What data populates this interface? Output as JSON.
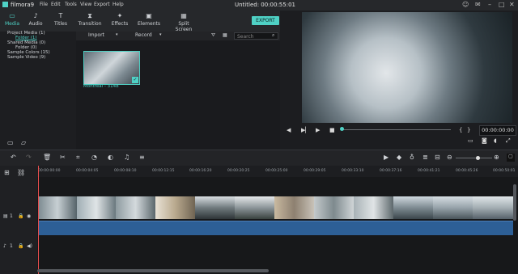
{
  "app": {
    "logo": "filmora9",
    "title": "Untitled:  00:00:55:01"
  },
  "menu": [
    "File",
    "Edit",
    "Tools",
    "View",
    "Export",
    "Help"
  ],
  "tabs": [
    {
      "label": "Media",
      "icon": "folder-icon",
      "active": true
    },
    {
      "label": "Audio",
      "icon": "music-note-icon"
    },
    {
      "label": "Titles",
      "icon": "text-icon"
    },
    {
      "label": "Transition",
      "icon": "transition-icon"
    },
    {
      "label": "Effects",
      "icon": "effects-icon"
    },
    {
      "label": "Elements",
      "icon": "image-icon"
    },
    {
      "label": "Split Screen",
      "icon": "split-screen-icon"
    }
  ],
  "export_label": "EXPORT",
  "library": {
    "items": [
      "Project Media (1)",
      "Folder (1)",
      "Shared Media (0)",
      "Folder (0)",
      "Sample Colors (15)",
      "Sample Video (9)"
    ]
  },
  "media_toolbar": {
    "import_label": "Import",
    "record_label": "Record",
    "search_placeholder": "Search"
  },
  "media_items": [
    {
      "name": "Montreal - 3148"
    }
  ],
  "player": {
    "timecode": "00:00:00:00"
  },
  "ruler_ticks": [
    "00:00:00:00",
    "00:00:04:05",
    "00:00:08:10",
    "00:00:12:15",
    "00:00:16:20",
    "00:00:20:25",
    "00:00:25:00",
    "00:00:29:05",
    "00:00:33:10",
    "00:00:37:16",
    "00:00:41:21",
    "00:00:45:26",
    "00:00:50:01"
  ],
  "tracks": {
    "video_label": "1",
    "audio_label": "1"
  },
  "colors": {
    "accent": "#4fd1c5",
    "audio_track": "#2d5f96",
    "playhead": "#e84e4e"
  }
}
